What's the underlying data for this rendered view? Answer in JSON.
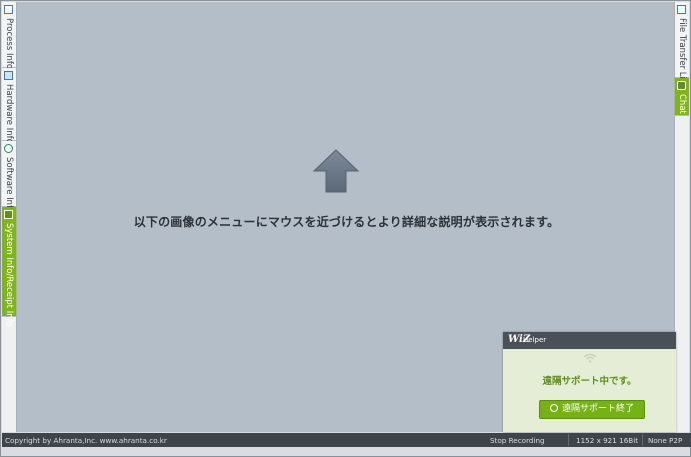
{
  "left_tabs": [
    {
      "label": "Process Info",
      "icon": "process-icon",
      "active": false
    },
    {
      "label": "Hardware Info",
      "icon": "hardware-icon",
      "active": false
    },
    {
      "label": "Software Info",
      "icon": "software-icon",
      "active": false
    },
    {
      "label": "System Info/Receipt Info",
      "icon": "system-icon",
      "active": true
    }
  ],
  "right_tabs": [
    {
      "label": "File Transfer List",
      "icon": "file-transfer-icon",
      "active": false
    },
    {
      "label": "Chat",
      "icon": "chat-icon",
      "active": true
    }
  ],
  "main": {
    "hint": "以下の画像のメニューにマウスを近づけるとより詳細な説明が表示されます。",
    "arrow_icon": "up-arrow-icon"
  },
  "wiz_helper": {
    "logo": "WiZ",
    "logo_sub": "Helper",
    "status": "遠隔サポート中です。",
    "end_button": "遠隔サポート終了"
  },
  "statusbar": {
    "copyright": "Copyright by Ahranta,Inc. www.ahranta.co.kr",
    "recording": "Stop Recording",
    "resolution": "1152 x 921 16Bit",
    "p2p": "None P2P"
  },
  "colors": {
    "accent_green": "#7fb519",
    "main_bg": "#b3bec9",
    "statusbar_bg": "#3e444b"
  }
}
